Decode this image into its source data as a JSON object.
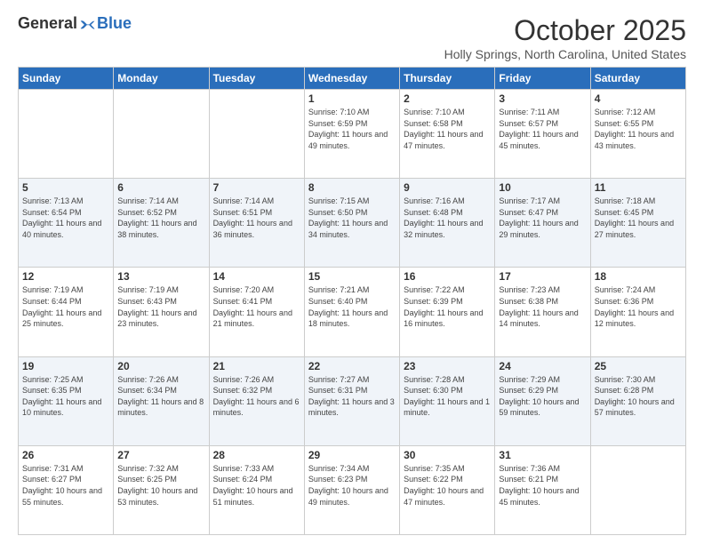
{
  "logo": {
    "general": "General",
    "blue": "Blue"
  },
  "title": {
    "month": "October 2025",
    "location": "Holly Springs, North Carolina, United States"
  },
  "days_of_week": [
    "Sunday",
    "Monday",
    "Tuesday",
    "Wednesday",
    "Thursday",
    "Friday",
    "Saturday"
  ],
  "weeks": [
    [
      {
        "day": "",
        "info": ""
      },
      {
        "day": "",
        "info": ""
      },
      {
        "day": "",
        "info": ""
      },
      {
        "day": "1",
        "info": "Sunrise: 7:10 AM\nSunset: 6:59 PM\nDaylight: 11 hours and 49 minutes."
      },
      {
        "day": "2",
        "info": "Sunrise: 7:10 AM\nSunset: 6:58 PM\nDaylight: 11 hours and 47 minutes."
      },
      {
        "day": "3",
        "info": "Sunrise: 7:11 AM\nSunset: 6:57 PM\nDaylight: 11 hours and 45 minutes."
      },
      {
        "day": "4",
        "info": "Sunrise: 7:12 AM\nSunset: 6:55 PM\nDaylight: 11 hours and 43 minutes."
      }
    ],
    [
      {
        "day": "5",
        "info": "Sunrise: 7:13 AM\nSunset: 6:54 PM\nDaylight: 11 hours and 40 minutes."
      },
      {
        "day": "6",
        "info": "Sunrise: 7:14 AM\nSunset: 6:52 PM\nDaylight: 11 hours and 38 minutes."
      },
      {
        "day": "7",
        "info": "Sunrise: 7:14 AM\nSunset: 6:51 PM\nDaylight: 11 hours and 36 minutes."
      },
      {
        "day": "8",
        "info": "Sunrise: 7:15 AM\nSunset: 6:50 PM\nDaylight: 11 hours and 34 minutes."
      },
      {
        "day": "9",
        "info": "Sunrise: 7:16 AM\nSunset: 6:48 PM\nDaylight: 11 hours and 32 minutes."
      },
      {
        "day": "10",
        "info": "Sunrise: 7:17 AM\nSunset: 6:47 PM\nDaylight: 11 hours and 29 minutes."
      },
      {
        "day": "11",
        "info": "Sunrise: 7:18 AM\nSunset: 6:45 PM\nDaylight: 11 hours and 27 minutes."
      }
    ],
    [
      {
        "day": "12",
        "info": "Sunrise: 7:19 AM\nSunset: 6:44 PM\nDaylight: 11 hours and 25 minutes."
      },
      {
        "day": "13",
        "info": "Sunrise: 7:19 AM\nSunset: 6:43 PM\nDaylight: 11 hours and 23 minutes."
      },
      {
        "day": "14",
        "info": "Sunrise: 7:20 AM\nSunset: 6:41 PM\nDaylight: 11 hours and 21 minutes."
      },
      {
        "day": "15",
        "info": "Sunrise: 7:21 AM\nSunset: 6:40 PM\nDaylight: 11 hours and 18 minutes."
      },
      {
        "day": "16",
        "info": "Sunrise: 7:22 AM\nSunset: 6:39 PM\nDaylight: 11 hours and 16 minutes."
      },
      {
        "day": "17",
        "info": "Sunrise: 7:23 AM\nSunset: 6:38 PM\nDaylight: 11 hours and 14 minutes."
      },
      {
        "day": "18",
        "info": "Sunrise: 7:24 AM\nSunset: 6:36 PM\nDaylight: 11 hours and 12 minutes."
      }
    ],
    [
      {
        "day": "19",
        "info": "Sunrise: 7:25 AM\nSunset: 6:35 PM\nDaylight: 11 hours and 10 minutes."
      },
      {
        "day": "20",
        "info": "Sunrise: 7:26 AM\nSunset: 6:34 PM\nDaylight: 11 hours and 8 minutes."
      },
      {
        "day": "21",
        "info": "Sunrise: 7:26 AM\nSunset: 6:32 PM\nDaylight: 11 hours and 6 minutes."
      },
      {
        "day": "22",
        "info": "Sunrise: 7:27 AM\nSunset: 6:31 PM\nDaylight: 11 hours and 3 minutes."
      },
      {
        "day": "23",
        "info": "Sunrise: 7:28 AM\nSunset: 6:30 PM\nDaylight: 11 hours and 1 minute."
      },
      {
        "day": "24",
        "info": "Sunrise: 7:29 AM\nSunset: 6:29 PM\nDaylight: 10 hours and 59 minutes."
      },
      {
        "day": "25",
        "info": "Sunrise: 7:30 AM\nSunset: 6:28 PM\nDaylight: 10 hours and 57 minutes."
      }
    ],
    [
      {
        "day": "26",
        "info": "Sunrise: 7:31 AM\nSunset: 6:27 PM\nDaylight: 10 hours and 55 minutes."
      },
      {
        "day": "27",
        "info": "Sunrise: 7:32 AM\nSunset: 6:25 PM\nDaylight: 10 hours and 53 minutes."
      },
      {
        "day": "28",
        "info": "Sunrise: 7:33 AM\nSunset: 6:24 PM\nDaylight: 10 hours and 51 minutes."
      },
      {
        "day": "29",
        "info": "Sunrise: 7:34 AM\nSunset: 6:23 PM\nDaylight: 10 hours and 49 minutes."
      },
      {
        "day": "30",
        "info": "Sunrise: 7:35 AM\nSunset: 6:22 PM\nDaylight: 10 hours and 47 minutes."
      },
      {
        "day": "31",
        "info": "Sunrise: 7:36 AM\nSunset: 6:21 PM\nDaylight: 10 hours and 45 minutes."
      },
      {
        "day": "",
        "info": ""
      }
    ]
  ]
}
